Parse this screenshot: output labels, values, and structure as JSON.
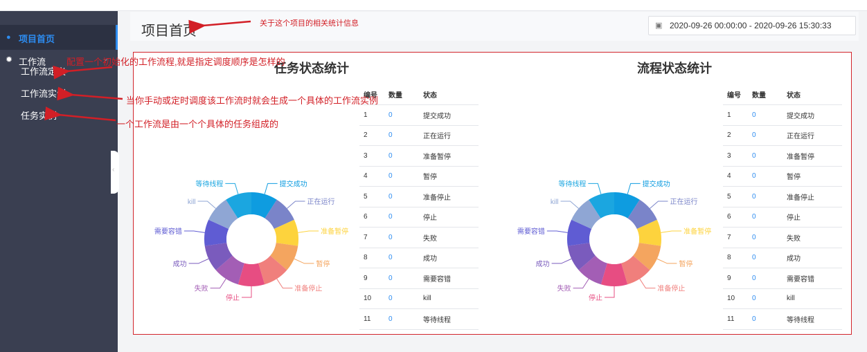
{
  "sidebar": {
    "home_label": "项目首页",
    "workflow_label": "工作流",
    "sub_items": [
      "工作流定义",
      "工作流实例",
      "任务实例"
    ],
    "active_color": "#2d8cf0"
  },
  "header": {
    "title": "项目首页",
    "date_range": "2020-09-26 00:00:00 - 2020-09-26 15:30:33"
  },
  "annotations": {
    "title_note": "关于这个项目的相关统计信息",
    "def_note": "配置一个初始化的工作流程,就是指定调度顺序是怎样的",
    "instance_note": "当你手动或定时调度该工作流时就会生成一个具体的工作流实例",
    "task_note": "一个工作流是由一个个具体的任务组成的"
  },
  "table_headers": [
    "编号",
    "数量",
    "状态"
  ],
  "chart_data": [
    {
      "type": "pie",
      "title": "任务状态统计",
      "categories": [
        "提交成功",
        "正在运行",
        "准备暂停",
        "暂停",
        "准备停止",
        "停止",
        "失败",
        "成功",
        "需要容错",
        "kill",
        "等待线程"
      ],
      "values": [
        0,
        0,
        0,
        0,
        0,
        0,
        0,
        0,
        0,
        0,
        0
      ],
      "ids": [
        "1",
        "2",
        "3",
        "4",
        "5",
        "6",
        "7",
        "8",
        "9",
        "10",
        "11"
      ],
      "colors": [
        "#0e9ce0",
        "#7a84c9",
        "#fdd33d",
        "#f4a55f",
        "#f07f7c",
        "#e74d82",
        "#a35eb5",
        "#7a5bbd",
        "#5f5cd3",
        "#8fa6d4",
        "#1ba6e0"
      ],
      "legend": "none"
    },
    {
      "type": "pie",
      "title": "流程状态统计",
      "categories": [
        "提交成功",
        "正在运行",
        "准备暂停",
        "暂停",
        "准备停止",
        "停止",
        "失败",
        "成功",
        "需要容错",
        "kill",
        "等待线程"
      ],
      "values": [
        0,
        0,
        0,
        0,
        0,
        0,
        0,
        0,
        0,
        0,
        0
      ],
      "ids": [
        "1",
        "2",
        "3",
        "4",
        "5",
        "6",
        "7",
        "8",
        "9",
        "10",
        "11"
      ],
      "colors": [
        "#0e9ce0",
        "#7a84c9",
        "#fdd33d",
        "#f4a55f",
        "#f07f7c",
        "#e74d82",
        "#a35eb5",
        "#7a5bbd",
        "#5f5cd3",
        "#8fa6d4",
        "#1ba6e0"
      ],
      "legend": "none"
    }
  ]
}
